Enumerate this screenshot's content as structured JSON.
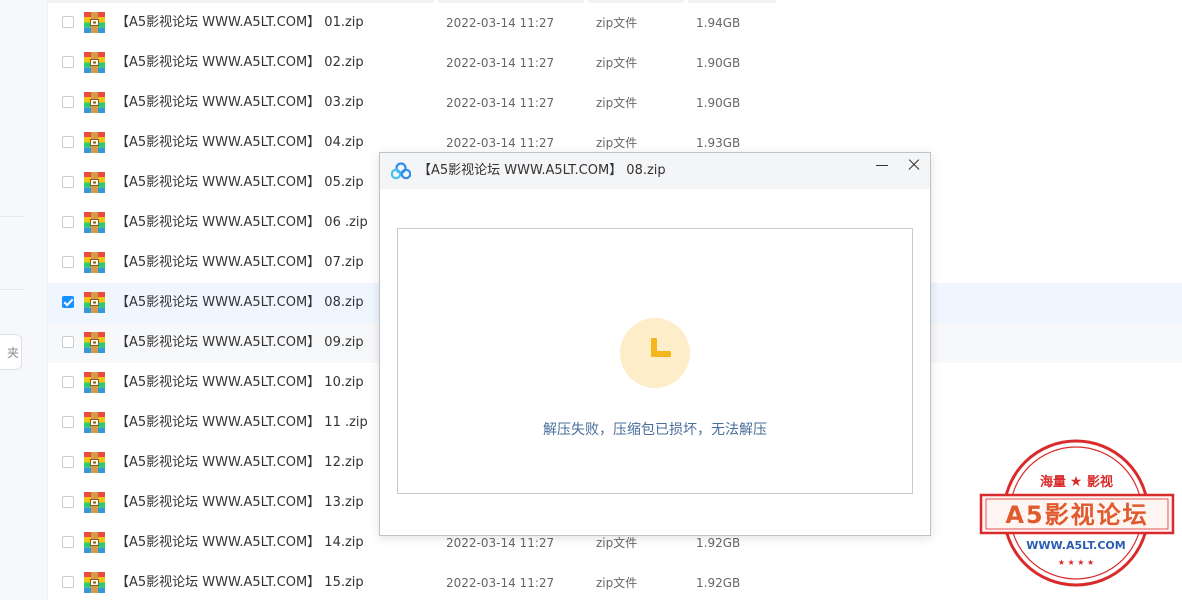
{
  "sidebar": {
    "partial_button_label": "夹"
  },
  "files": [
    {
      "name": "【A5影视论坛 WWW.A5LT.COM】 01.zip",
      "date": "2022-03-14 11:27",
      "type": "zip文件",
      "size": "1.94GB"
    },
    {
      "name": "【A5影视论坛 WWW.A5LT.COM】 02.zip",
      "date": "2022-03-14 11:27",
      "type": "zip文件",
      "size": "1.90GB"
    },
    {
      "name": "【A5影视论坛 WWW.A5LT.COM】 03.zip",
      "date": "2022-03-14 11:27",
      "type": "zip文件",
      "size": "1.90GB"
    },
    {
      "name": "【A5影视论坛 WWW.A5LT.COM】 04.zip",
      "date": "2022-03-14 11:27",
      "type": "zip文件",
      "size": "1.93GB"
    },
    {
      "name": "【A5影视论坛 WWW.A5LT.COM】 05.zip",
      "date": "",
      "type": "",
      "size": ""
    },
    {
      "name": "【A5影视论坛 WWW.A5LT.COM】 06 .zip",
      "date": "",
      "type": "",
      "size": ""
    },
    {
      "name": "【A5影视论坛 WWW.A5LT.COM】 07.zip",
      "date": "",
      "type": "",
      "size": ""
    },
    {
      "name": "【A5影视论坛 WWW.A5LT.COM】 08.zip",
      "date": "",
      "type": "",
      "size": ""
    },
    {
      "name": "【A5影视论坛 WWW.A5LT.COM】 09.zip",
      "date": "",
      "type": "",
      "size": ""
    },
    {
      "name": "【A5影视论坛 WWW.A5LT.COM】 10.zip",
      "date": "",
      "type": "",
      "size": ""
    },
    {
      "name": "【A5影视论坛 WWW.A5LT.COM】 11 .zip",
      "date": "",
      "type": "",
      "size": ""
    },
    {
      "name": "【A5影视论坛 WWW.A5LT.COM】 12.zip",
      "date": "",
      "type": "",
      "size": ""
    },
    {
      "name": "【A5影视论坛 WWW.A5LT.COM】 13.zip",
      "date": "",
      "type": "",
      "size": ""
    },
    {
      "name": "【A5影视论坛 WWW.A5LT.COM】 14.zip",
      "date": "2022-03-14 11:27",
      "type": "zip文件",
      "size": "1.92GB"
    },
    {
      "name": "【A5影视论坛 WWW.A5LT.COM】 15.zip",
      "date": "2022-03-14 11:27",
      "type": "zip文件",
      "size": "1.92GB"
    }
  ],
  "selected_index": 7,
  "dialog": {
    "title": "【A5影视论坛 WWW.A5LT.COM】 08.zip",
    "message": "解压失败，压缩包已损坏，无法解压"
  },
  "watermark": {
    "top_text": "海量",
    "top_text2": "影视",
    "banner": "A5影视论坛",
    "url": "WWW.A5LT.COM"
  },
  "colors": {
    "accent": "#1890ff",
    "selected_row": "#f0f6ff",
    "clock_bg": "#fdedc8",
    "clock_hand": "#f5b51c",
    "message": "#4a6e9a",
    "stamp_red": "#d92b2b"
  }
}
